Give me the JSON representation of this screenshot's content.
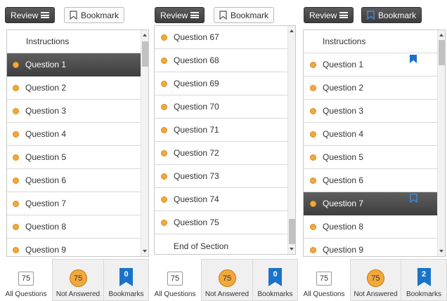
{
  "colors": {
    "dot_orange": "#f2a83b",
    "bookmark_blue": "#1a73c9",
    "selected_dark": "#4a4a4a"
  },
  "icons": {
    "review": "list-lines-icon",
    "bookmark": "bookmark-icon",
    "answered_dot": "status-dot-icon"
  },
  "panels": [
    {
      "toolbar": {
        "review_label": "Review",
        "bookmark_label": "Bookmark",
        "bookmark_active": false
      },
      "items": [
        {
          "label": "Instructions",
          "dot": false,
          "selected": false,
          "bookmarked": false
        },
        {
          "label": "Question 1",
          "dot": true,
          "selected": true,
          "bookmarked": false
        },
        {
          "label": "Question 2",
          "dot": true,
          "selected": false,
          "bookmarked": false
        },
        {
          "label": "Question 3",
          "dot": true,
          "selected": false,
          "bookmarked": false
        },
        {
          "label": "Question 4",
          "dot": true,
          "selected": false,
          "bookmarked": false
        },
        {
          "label": "Question 5",
          "dot": true,
          "selected": false,
          "bookmarked": false
        },
        {
          "label": "Question 6",
          "dot": true,
          "selected": false,
          "bookmarked": false
        },
        {
          "label": "Question 7",
          "dot": true,
          "selected": false,
          "bookmarked": false
        },
        {
          "label": "Question 8",
          "dot": true,
          "selected": false,
          "bookmarked": false
        },
        {
          "label": "Question 9",
          "dot": true,
          "selected": false,
          "bookmarked": false
        }
      ],
      "footer": {
        "all_count": "75",
        "all_label": "All Questions",
        "not_answered_count": "75",
        "not_answered_label": "Not Answered",
        "bookmarks_count": "0",
        "bookmarks_label": "Bookmarks"
      }
    },
    {
      "toolbar": {
        "review_label": "Review",
        "bookmark_label": "Bookmark",
        "bookmark_active": false
      },
      "items": [
        {
          "label": "Question 67",
          "dot": true,
          "selected": false,
          "bookmarked": false
        },
        {
          "label": "Question 68",
          "dot": true,
          "selected": false,
          "bookmarked": false
        },
        {
          "label": "Question 69",
          "dot": true,
          "selected": false,
          "bookmarked": false
        },
        {
          "label": "Question 70",
          "dot": true,
          "selected": false,
          "bookmarked": false
        },
        {
          "label": "Question 71",
          "dot": true,
          "selected": false,
          "bookmarked": false
        },
        {
          "label": "Question 72",
          "dot": true,
          "selected": false,
          "bookmarked": false
        },
        {
          "label": "Question 73",
          "dot": true,
          "selected": false,
          "bookmarked": false
        },
        {
          "label": "Question 74",
          "dot": true,
          "selected": false,
          "bookmarked": false
        },
        {
          "label": "Question 75",
          "dot": true,
          "selected": false,
          "bookmarked": false
        },
        {
          "label": "End of Section",
          "dot": false,
          "selected": false,
          "bookmarked": false
        }
      ],
      "footer": {
        "all_count": "75",
        "all_label": "All Questions",
        "not_answered_count": "75",
        "not_answered_label": "Not Answered",
        "bookmarks_count": "0",
        "bookmarks_label": "Bookmarks"
      }
    },
    {
      "toolbar": {
        "review_label": "Review",
        "bookmark_label": "Bookmark",
        "bookmark_active": true
      },
      "items": [
        {
          "label": "Instructions",
          "dot": false,
          "selected": false,
          "bookmarked": false
        },
        {
          "label": "Question 1",
          "dot": true,
          "selected": false,
          "bookmarked": true
        },
        {
          "label": "Question 2",
          "dot": true,
          "selected": false,
          "bookmarked": false
        },
        {
          "label": "Question 3",
          "dot": true,
          "selected": false,
          "bookmarked": false
        },
        {
          "label": "Question 4",
          "dot": true,
          "selected": false,
          "bookmarked": false
        },
        {
          "label": "Question 5",
          "dot": true,
          "selected": false,
          "bookmarked": false
        },
        {
          "label": "Question 6",
          "dot": true,
          "selected": false,
          "bookmarked": false
        },
        {
          "label": "Question 7",
          "dot": true,
          "selected": true,
          "bookmarked": true
        },
        {
          "label": "Question 8",
          "dot": true,
          "selected": false,
          "bookmarked": false
        },
        {
          "label": "Question 9",
          "dot": true,
          "selected": false,
          "bookmarked": false
        }
      ],
      "footer": {
        "all_count": "75",
        "all_label": "All Questions",
        "not_answered_count": "75",
        "not_answered_label": "Not Answered",
        "bookmarks_count": "2",
        "bookmarks_label": "Bookmarks"
      }
    }
  ]
}
